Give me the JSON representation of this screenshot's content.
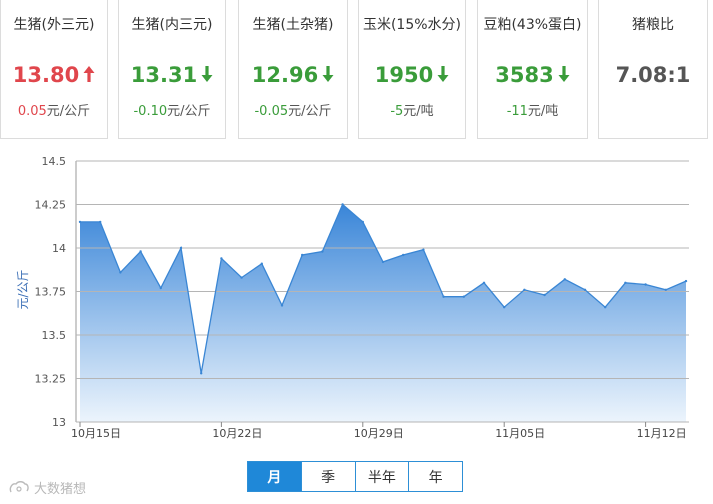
{
  "cards": [
    {
      "title": "生猪(外三元)",
      "value": "13.80",
      "trend": "up",
      "change": "0.05",
      "unit": "元/公斤"
    },
    {
      "title": "生猪(内三元)",
      "value": "13.31",
      "trend": "down",
      "change": "-0.10",
      "unit": "元/公斤"
    },
    {
      "title": "生猪(土杂猪)",
      "value": "12.96",
      "trend": "down",
      "change": "-0.05",
      "unit": "元/公斤"
    },
    {
      "title": "玉米(15%水分)",
      "value": "1950",
      "trend": "down",
      "change": "-5",
      "unit": "元/吨"
    },
    {
      "title": "豆粕(43%蛋白)",
      "value": "3583",
      "trend": "down",
      "change": "-11",
      "unit": "元/吨"
    },
    {
      "title": "猪粮比",
      "value": "7.08:1",
      "trend": "none",
      "change": "",
      "unit": ""
    }
  ],
  "colors": {
    "up": "#e0464c",
    "down": "#3a9c3a",
    "line": "#3a86d4",
    "area_top": "#2f7fd6",
    "area_bottom": "#eaf3fc",
    "grid": "#b5b5b5"
  },
  "chart_data": {
    "type": "area",
    "ylabel": "元/公斤",
    "ylim": [
      13,
      14.5
    ],
    "yticks": [
      13,
      13.25,
      13.5,
      13.75,
      14,
      14.25,
      14.5
    ],
    "xticks": [
      "10月15日",
      "10月22日",
      "10月29日",
      "11月05日",
      "11月12日"
    ],
    "xtick_indices": [
      0,
      7,
      14,
      21,
      28
    ],
    "grid": true,
    "values": [
      14.15,
      14.15,
      13.86,
      13.98,
      13.77,
      14.0,
      13.28,
      13.94,
      13.83,
      13.91,
      13.67,
      13.96,
      13.98,
      14.25,
      14.15,
      13.92,
      13.96,
      13.99,
      13.72,
      13.72,
      13.8,
      13.66,
      13.76,
      13.73,
      13.82,
      13.76,
      13.66,
      13.8,
      13.79,
      13.76,
      13.81
    ]
  },
  "periods": {
    "options": [
      "月",
      "季",
      "半年",
      "年"
    ],
    "active": 0
  },
  "watermark": {
    "text": "大数猪想"
  }
}
